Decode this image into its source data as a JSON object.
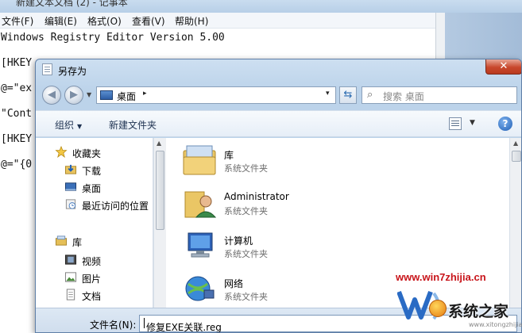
{
  "notepad": {
    "title": "新建文本文档 (2) - 记事本",
    "menu": [
      "文件(F)",
      "编辑(E)",
      "格式(O)",
      "查看(V)",
      "帮助(H)"
    ],
    "lines": [
      "Windows Registry Editor Version 5.00",
      "[HKEY",
      "@=\"ex",
      "\"Cont",
      "[HKEY",
      "@=\"{0"
    ]
  },
  "dialog": {
    "title": "另存为",
    "close_label": "✕",
    "address": {
      "location": "桌面",
      "arrow": "▸",
      "dropdown": "▾"
    },
    "refresh_glyph": "⇆",
    "search": {
      "placeholder": "搜索 桌面"
    },
    "toolbar": {
      "organize": "组织",
      "new_folder": "新建文件夹",
      "help": "?"
    },
    "nav": {
      "favorites": "收藏夹",
      "downloads": "下载",
      "desktop": "桌面",
      "recent": "最近访问的位置",
      "libraries": "库",
      "videos": "视频",
      "pictures": "图片",
      "documents": "文档"
    },
    "files": [
      {
        "name": "库",
        "type": "系统文件夹",
        "icon": "library-folder-icon"
      },
      {
        "name": "Administrator",
        "type": "系统文件夹",
        "icon": "user-folder-icon"
      },
      {
        "name": "计算机",
        "type": "系统文件夹",
        "icon": "computer-icon"
      },
      {
        "name": "网络",
        "type": "系统文件夹",
        "icon": "network-icon"
      }
    ],
    "filename": {
      "label": "文件名(N):",
      "value": "修复EXE关联.reg"
    }
  },
  "watermark": {
    "url": "www.win7zhijia.cn",
    "brand": "系统之家",
    "site": "www.xitongzhijia.net"
  },
  "colors": {
    "close": "#c8482c",
    "watermark_red": "#c8141a",
    "accent": "#1f5fb5"
  }
}
